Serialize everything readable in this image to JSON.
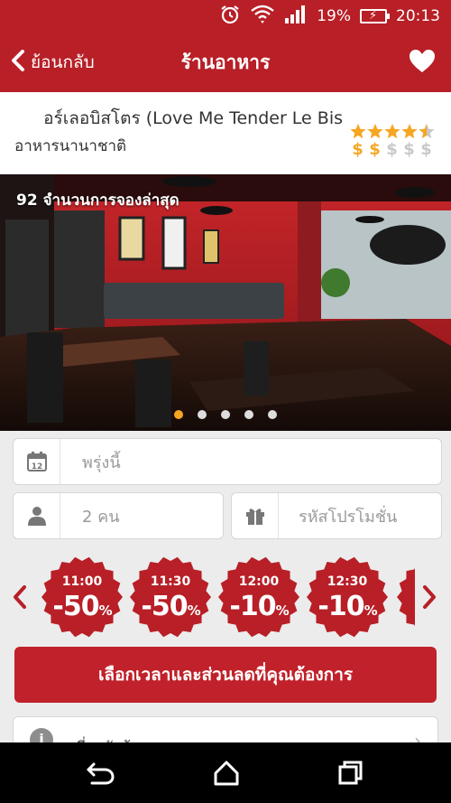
{
  "status_bar": {
    "battery_percent": "19%",
    "time": "20:13",
    "icons": [
      "alarm-icon",
      "wifi-icon",
      "signal-icon",
      "battery-charging-icon"
    ]
  },
  "app_bar": {
    "back_label": "ย้อนกลับ",
    "title": "ร้านอาหาร",
    "favorite_icon": "heart-icon"
  },
  "restaurant": {
    "name": "อร์เลอบิสโตร (Love Me Tender Le Bis",
    "category": "อาหารนานาชาติ",
    "star_rating": 4.5,
    "price_level": 2,
    "price_scale": 5,
    "price_symbol": "$",
    "accent_color": "#f5a623"
  },
  "gallery": {
    "booking_count_label": "92 จำนวนการจองล่าสุด",
    "total_images": 5,
    "active_index": 0
  },
  "booking_form": {
    "date_value": "พรุ่งนี้",
    "guests_value": "2 คน",
    "promo_placeholder": "รหัสโปรโมชั่น",
    "icons": {
      "date": "calendar-icon",
      "guests": "person-icon",
      "promo": "gift-icon"
    }
  },
  "timeslots": [
    {
      "time": "11:00",
      "discount": "-50",
      "unit": "%"
    },
    {
      "time": "11:30",
      "discount": "-50",
      "unit": "%"
    },
    {
      "time": "12:00",
      "discount": "-10",
      "unit": "%"
    },
    {
      "time": "12:30",
      "discount": "-10",
      "unit": "%"
    }
  ],
  "cta_label": "เลือกเวลาและส่วนลดที่คุณต้องการ",
  "about_label": "เกี่ยวกับร้านอาหาร",
  "colors": {
    "brand_red": "#b81f27",
    "button_red": "#c1212a",
    "star_gold": "#f5a623"
  }
}
